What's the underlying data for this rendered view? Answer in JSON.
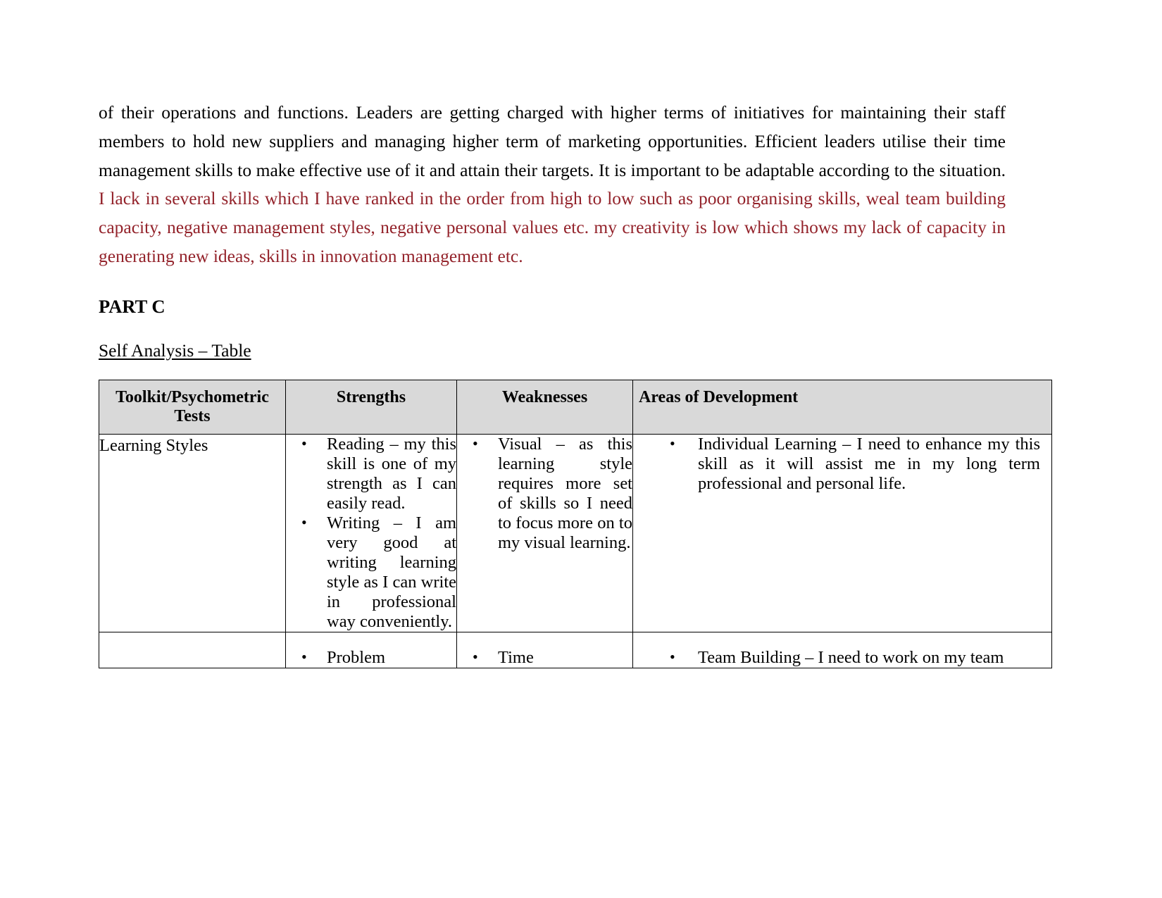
{
  "document": {
    "paragraph": {
      "black_part": "of their operations and functions. Leaders are getting charged with higher terms of initiatives for maintaining their staff members to hold new suppliers and managing higher term of marketing opportunities. Efficient leaders utilise their time management skills to make effective use of it and attain their targets. It is important to be adaptable according to the situation. ",
      "red_part": " I lack in several skills which I have ranked in the order from high to low such as poor organising skills, weal team building capacity, negative management styles, negative personal values etc. my creativity is low which shows my lack of capacity in generating new ideas, skills in innovation management etc.",
      "red_color": "#93222a"
    },
    "part_heading": "PART C",
    "sub_heading": "Self Analysis – Table",
    "table": {
      "header_background": "#d9d9d9",
      "columns": [
        "Toolkit/Psychometric Tests",
        "Strengths",
        "Weaknesses",
        "Areas of Development"
      ],
      "rows": [
        {
          "label": "Learning Styles",
          "strengths": [
            "Reading – my this skill is one of my strength as I can easily read.",
            "Writing – I am very good at writing learning style as I can write in professional way conveniently."
          ],
          "weaknesses": [
            "Visual – as this learning style requires more set of skills so I need to focus more on to my visual learning."
          ],
          "areas_of_development": [
            "Individual Learning – I need to enhance my this skill as it will assist me in my long term professional and personal life."
          ]
        },
        {
          "label": "",
          "strengths": [
            "Problem"
          ],
          "weaknesses": [
            "Time"
          ],
          "areas_of_development": [
            "Team Building – I need to work on my team"
          ]
        }
      ]
    }
  }
}
